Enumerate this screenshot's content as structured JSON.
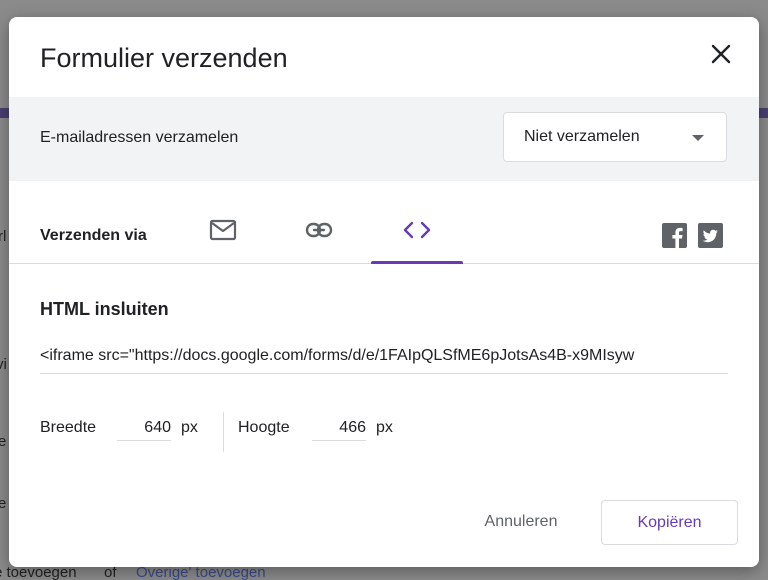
{
  "background": {
    "fragment_1": "rl",
    "fragment_2": "vi",
    "fragment_3": "e",
    "fragment_4": "e",
    "bottom_text": "e toevoegen",
    "bottom_or": "of",
    "bottom_link": "Overige' toevoegen"
  },
  "dialog": {
    "title": "Formulier verzenden",
    "close_icon": "close-icon",
    "collect": {
      "label": "E-mailadressen verzamelen",
      "selected": "Niet verzamelen"
    },
    "send": {
      "label": "Verzenden via",
      "tabs": [
        {
          "icon": "email-icon"
        },
        {
          "icon": "link-icon"
        },
        {
          "icon": "embed-code-icon",
          "active": true
        }
      ],
      "social": [
        "facebook-icon",
        "twitter-icon"
      ]
    },
    "embed": {
      "title": "HTML insluiten",
      "code": "<iframe src=\"https://docs.google.com/forms/d/e/1FAIpQLSfME6pJotsAs4B-x9MIsyw",
      "width_label": "Breedte",
      "width_value": "640",
      "width_unit": "px",
      "height_label": "Hoogte",
      "height_value": "466",
      "height_unit": "px"
    },
    "actions": {
      "cancel": "Annuleren",
      "copy": "Kopiëren"
    }
  },
  "colors": {
    "accent": "#673ab7",
    "text": "#202124",
    "muted": "#5f6368",
    "divider": "#dadce0"
  }
}
